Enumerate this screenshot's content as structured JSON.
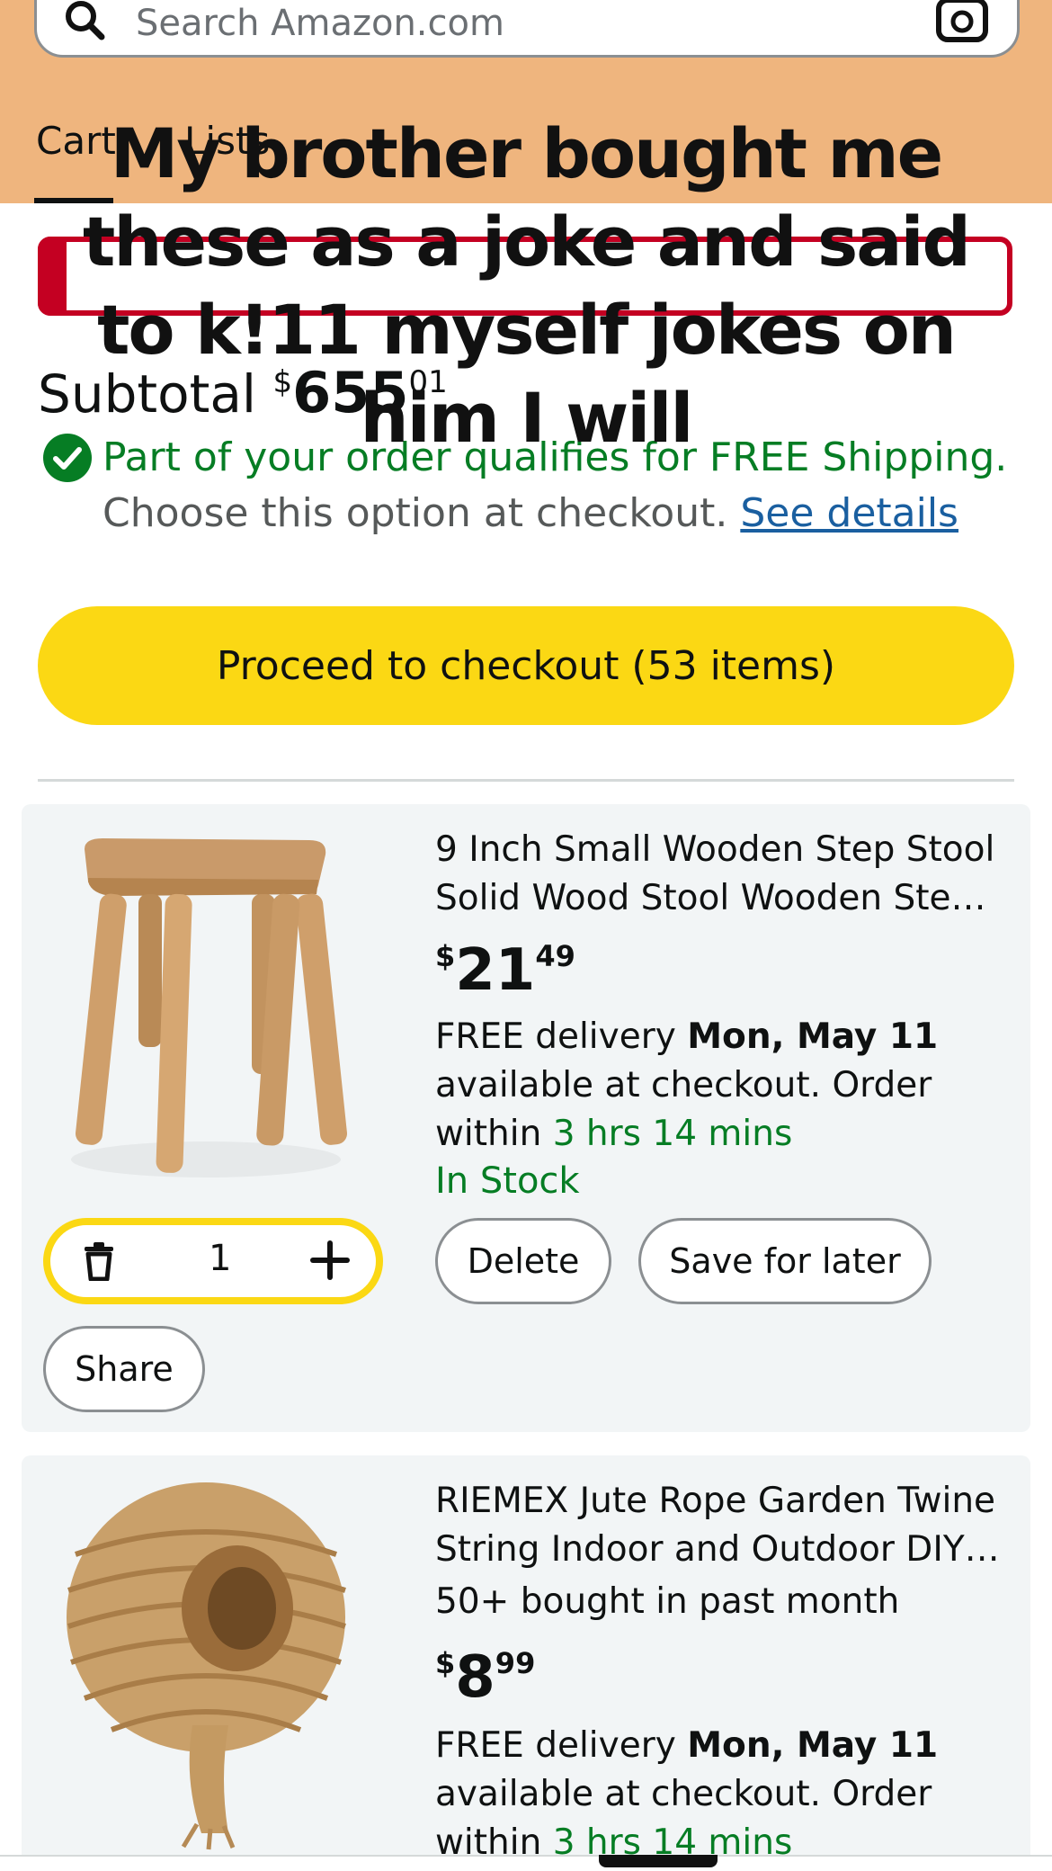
{
  "header": {
    "search_placeholder": "Search Amazon.com",
    "tabs": [
      {
        "label": "Cart"
      },
      {
        "label": "Lists"
      }
    ]
  },
  "caption": "My brother bought me these as a joke and said to k!11 myself jokes on him I will",
  "subtotal": {
    "label": "Subtotal",
    "currency": "$",
    "whole": "655",
    "fraction": "01"
  },
  "shipping": {
    "line1": "Part of your order qualifies for FREE Shipping.",
    "line2": "Choose this option at checkout.",
    "link": "See details"
  },
  "checkout": {
    "label": "Proceed to checkout (53 items)"
  },
  "items": [
    {
      "title1": "9 Inch Small Wooden Step Stool",
      "title2": "Solid Wood Stool Wooden Ste…",
      "currency": "$",
      "price_whole": "21",
      "price_fraction": "49",
      "delivery_prefix": "FREE delivery",
      "delivery_date": "Mon, May 11",
      "delivery_mid": "available at checkout. Order within",
      "delivery_time": "3 hrs 14 mins",
      "stock": "In Stock",
      "quantity": "1",
      "delete_label": "Delete",
      "save_label": "Save for later",
      "share_label": "Share"
    },
    {
      "title1": "RIEMEX Jute Rope Garden Twine",
      "title2": "String Indoor and Outdoor DIY…",
      "bought": "50+ bought in past month",
      "currency": "$",
      "price_whole": "8",
      "price_fraction": "99",
      "delivery_prefix": "FREE delivery",
      "delivery_date": "Mon, May 11",
      "delivery_mid": "available at checkout. Order within",
      "delivery_time": "3 hrs 14 mins"
    }
  ],
  "colors": {
    "header_bg": "#efb57e",
    "checkout_yellow": "#fbd814",
    "free_green": "#067d24",
    "link_blue": "#1a5fa0",
    "alert_red": "#c40022"
  }
}
